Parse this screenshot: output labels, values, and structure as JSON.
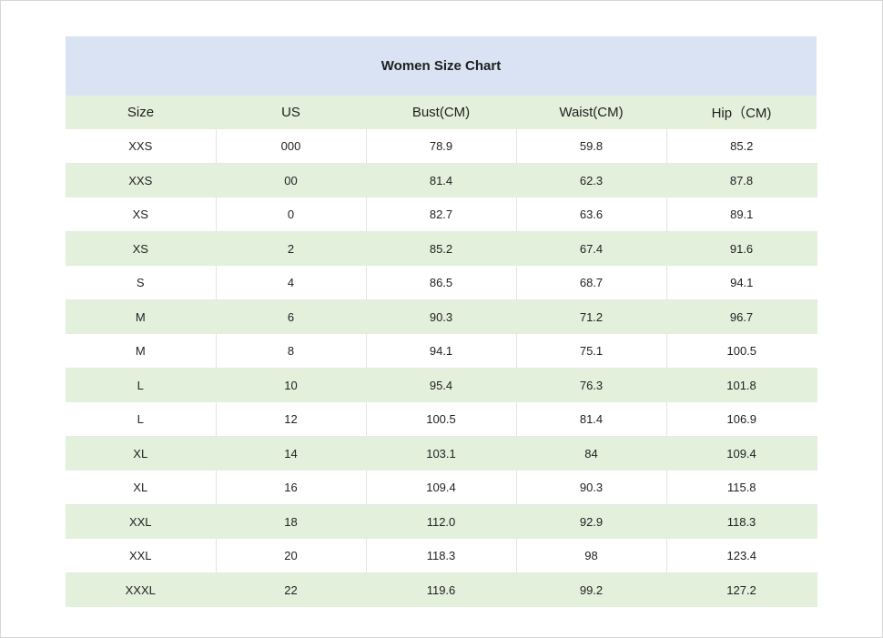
{
  "chart_data": {
    "type": "table",
    "title": "Women Size Chart",
    "columns": [
      "Size",
      "US",
      "Bust(CM)",
      "Waist(CM)",
      "Hip（CM)"
    ],
    "rows": [
      [
        "XXS",
        "000",
        "78.9",
        "59.8",
        "85.2"
      ],
      [
        "XXS",
        "00",
        "81.4",
        "62.3",
        "87.8"
      ],
      [
        "XS",
        "0",
        "82.7",
        "63.6",
        "89.1"
      ],
      [
        "XS",
        "2",
        "85.2",
        "67.4",
        "91.6"
      ],
      [
        "S",
        "4",
        "86.5",
        "68.7",
        "94.1"
      ],
      [
        "M",
        "6",
        "90.3",
        "71.2",
        "96.7"
      ],
      [
        "M",
        "8",
        "94.1",
        "75.1",
        "100.5"
      ],
      [
        "L",
        "10",
        "95.4",
        "76.3",
        "101.8"
      ],
      [
        "L",
        "12",
        "100.5",
        "81.4",
        "106.9"
      ],
      [
        "XL",
        "14",
        "103.1",
        "84",
        "109.4"
      ],
      [
        "XL",
        "16",
        "109.4",
        "90.3",
        "115.8"
      ],
      [
        "XXL",
        "18",
        "112.0",
        "92.9",
        "118.3"
      ],
      [
        "XXL",
        "20",
        "118.3",
        "98",
        "123.4"
      ],
      [
        "XXXL",
        "22",
        "119.6",
        "99.2",
        "127.2"
      ]
    ]
  },
  "colors": {
    "title_background": "#d9e3f3",
    "header_background": "#e3f0dc",
    "stripe_background": "#e3f0dc"
  }
}
